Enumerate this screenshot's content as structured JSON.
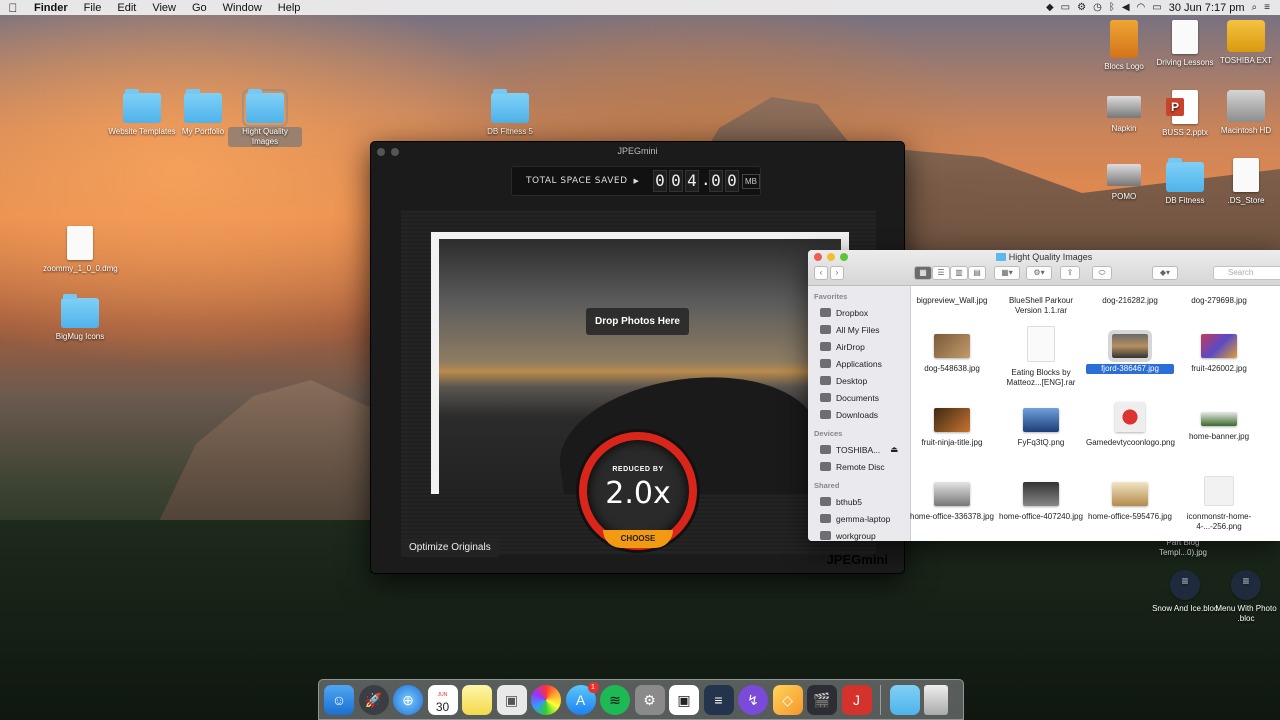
{
  "menubar": {
    "app_name": "Finder",
    "menus": [
      "File",
      "Edit",
      "View",
      "Go",
      "Window",
      "Help"
    ],
    "datetime": "30 Jun  7:17 pm"
  },
  "desktop_left": [
    {
      "label": "Website Templates"
    },
    {
      "label": "My Portfolio"
    },
    {
      "label": "Hight Quality Images"
    },
    {
      "label": "DB Fitness 5"
    },
    {
      "label": "zoommy_1_0_0.dmg"
    },
    {
      "label": "BigMug Icons"
    }
  ],
  "desktop_right": [
    {
      "label": "Blocs Logo"
    },
    {
      "label": "Driving Lessons"
    },
    {
      "label": "TOSHIBA EXT"
    },
    {
      "label": "Napkin"
    },
    {
      "label": "BUSS 2.pptx"
    },
    {
      "label": "Macintosh HD"
    },
    {
      "label": "POMO"
    },
    {
      "label": "DB Fitness"
    },
    {
      "label": ".DS_Store"
    },
    {
      "label": "Part Blog Templ...0).jpg"
    },
    {
      "label": "Snow And Ice.bloc"
    },
    {
      "label": "Menu With Photo .bloc"
    }
  ],
  "jpegmini": {
    "title": "JPEGmini",
    "total_label": "TOTAL SPACE SAVED",
    "digits": [
      "0",
      "0",
      "4",
      ".",
      "0",
      "0"
    ],
    "unit": "MB",
    "drop_label": "Drop Photos Here",
    "reduced_label": "REDUCED BY",
    "reduced_value": "2.0x",
    "choose_label": "CHOOSE",
    "optimize_label": "Optimize Originals",
    "brand": "JPEGmini"
  },
  "finder": {
    "title": "Hight Quality Images",
    "search_placeholder": "Search",
    "sidebar": {
      "favorites_title": "Favorites",
      "favorites": [
        "Dropbox",
        "All My Files",
        "AirDrop",
        "Applications",
        "Desktop",
        "Documents",
        "Downloads"
      ],
      "devices_title": "Devices",
      "devices": [
        "TOSHIBA...",
        "Remote Disc"
      ],
      "shared_title": "Shared",
      "shared": [
        "bthub5",
        "gemma-laptop",
        "workgroup"
      ]
    },
    "files": [
      {
        "name": "bigpreview_Wall.jpg"
      },
      {
        "name": "BlueShell Parkour Version 1.1.rar"
      },
      {
        "name": "dog-216282.jpg"
      },
      {
        "name": "dog-279698.jpg"
      },
      {
        "name": "dog-548638.jpg"
      },
      {
        "name": "Eating Blocks by Matteoz...[ENG].rar"
      },
      {
        "name": "fjord-386467.jpg",
        "selected": true
      },
      {
        "name": "fruit-426002.jpg"
      },
      {
        "name": "fruit-ninja-title.jpg"
      },
      {
        "name": "FyFq3tQ.png"
      },
      {
        "name": "Gamedevtycoonlogo.png"
      },
      {
        "name": "home-banner.jpg"
      },
      {
        "name": "home-office-336378.jpg"
      },
      {
        "name": "home-office-407240.jpg"
      },
      {
        "name": "home-office-595476.jpg"
      },
      {
        "name": "iconmonstr-home-4-...-256.png"
      }
    ]
  },
  "dock": {
    "calendar_day": "30",
    "calendar_month": "JUN",
    "appstore_badge": "1"
  }
}
